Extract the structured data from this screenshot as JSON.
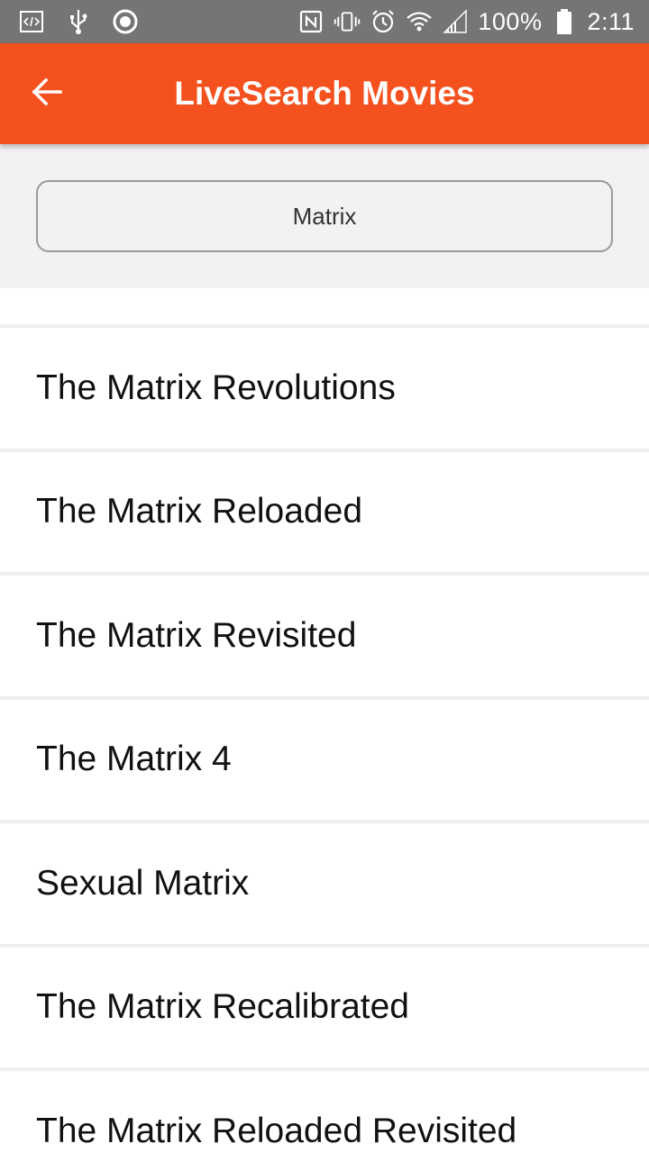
{
  "status_bar": {
    "left_icons": [
      "code-icon",
      "usb-icon",
      "circle-icon"
    ],
    "right_icons": [
      "nfc-icon",
      "vibrate-icon",
      "alarm-icon",
      "wifi-icon",
      "signal-icon",
      "battery-icon"
    ],
    "battery": "100%",
    "time": "2:11"
  },
  "app_bar": {
    "title": "LiveSearch Movies",
    "back_icon": "arrow-left-icon",
    "color": "#F4511E"
  },
  "search": {
    "value": "Matrix",
    "placeholder": ""
  },
  "results": {
    "items": [
      {
        "title": "The Matrix Revolutions"
      },
      {
        "title": "The Matrix Reloaded"
      },
      {
        "title": "The Matrix Revisited"
      },
      {
        "title": "The Matrix 4"
      },
      {
        "title": "Sexual Matrix"
      },
      {
        "title": "The Matrix Recalibrated"
      },
      {
        "title": "The Matrix Reloaded Revisited"
      }
    ]
  }
}
